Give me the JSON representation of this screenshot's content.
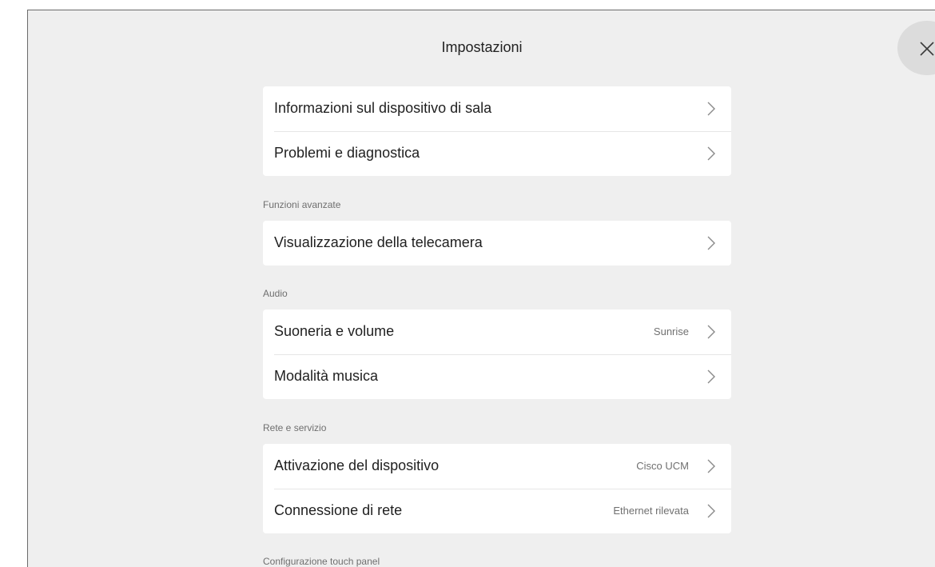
{
  "header": {
    "title": "Impostazioni"
  },
  "close_icon": "close-icon",
  "groups": [
    {
      "section": "",
      "rows": [
        {
          "label": "Informazioni sul dispositivo di sala",
          "value": ""
        },
        {
          "label": "Problemi e diagnostica",
          "value": ""
        }
      ]
    },
    {
      "section": "Funzioni avanzate",
      "rows": [
        {
          "label": "Visualizzazione della telecamera",
          "value": ""
        }
      ]
    },
    {
      "section": "Audio",
      "rows": [
        {
          "label": "Suoneria e volume",
          "value": "Sunrise"
        },
        {
          "label": "Modalità musica",
          "value": ""
        }
      ]
    },
    {
      "section": "Rete e servizio",
      "rows": [
        {
          "label": "Attivazione del dispositivo",
          "value": "Cisco UCM"
        },
        {
          "label": "Connessione di rete",
          "value": "Ethernet rilevata"
        }
      ]
    },
    {
      "section": "Configurazione touch panel",
      "rows": []
    }
  ],
  "colors": {
    "background": "#efefef",
    "card": "#ffffff",
    "text": "#1f1f1f",
    "secondary_text": "#707070"
  }
}
